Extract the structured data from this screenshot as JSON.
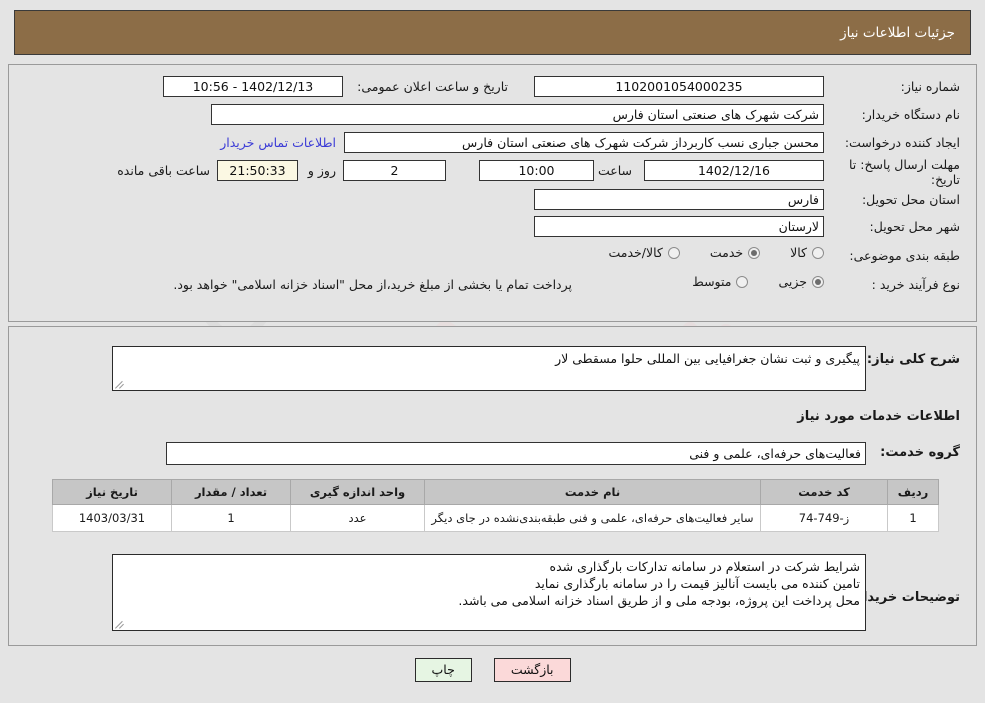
{
  "header": {
    "title": "جزئیات اطلاعات نیاز"
  },
  "top_section": {
    "labels": {
      "need_number": "شماره نیاز:",
      "buyer_org": "نام دستگاه خریدار:",
      "requester": "ایجاد کننده درخواست:",
      "response_deadline": "مهلت ارسال پاسخ: تا تاریخ:",
      "delivery_province": "استان محل تحویل:",
      "delivery_city": "شهر محل تحویل:",
      "subject_classification": "طبقه بندی موضوعی:",
      "purchase_process_type": "نوع فرآیند خرید :",
      "public_announce_datetime": "تاریخ و ساعت اعلان عمومی:",
      "hour": "ساعت",
      "days_and": "روز و",
      "hours_remaining": "ساعت باقی مانده"
    },
    "values": {
      "need_number": "1102001054000235",
      "buyer_org": "شرکت شهرک های صنعتی استان فارس",
      "requester": "محسن  جباری نسب کاربرداز شرکت شهرک های صنعتی استان فارس",
      "response_deadline_date": "1402/12/16",
      "response_deadline_hour": "10:00",
      "remaining_days": "2",
      "remaining_time": "21:50:33",
      "delivery_province": "فارس",
      "delivery_city": "لارستان",
      "public_announce_datetime": "1402/12/13 - 10:56"
    },
    "buyer_contact_link": "اطلاعات تماس خریدار",
    "classification_options": [
      {
        "label": "کالا",
        "selected": false
      },
      {
        "label": "خدمت",
        "selected": true
      },
      {
        "label": "کالا/خدمت",
        "selected": false
      }
    ],
    "process_options": [
      {
        "label": "جزیی",
        "selected": true
      },
      {
        "label": "متوسط",
        "selected": false
      }
    ],
    "treasury_note": "پرداخت تمام یا بخشی از مبلغ خرید،از محل \"اسناد خزانه اسلامی\" خواهد بود."
  },
  "middle_section": {
    "need_summary_label": "شرح کلی نیاز:",
    "need_summary_value": "پیگیری و ثبت نشان جغرافیایی بین المللی حلوا مسقطی لار",
    "services_heading": "اطلاعات خدمات مورد نیاز",
    "service_group_label": "گروه خدمت:",
    "service_group_value": "فعالیت‌های حرفه‌ای، علمی و فنی",
    "table": {
      "headers": [
        "ردیف",
        "کد خدمت",
        "نام خدمت",
        "واحد اندازه گیری",
        "تعداد / مقدار",
        "تاریخ نیاز"
      ],
      "rows": [
        {
          "row_no": "1",
          "service_code": "ز-749-74",
          "service_name": "سایر فعالیت‌های حرفه‌ای، علمی و فنی طبقه‌بندی‌نشده در جای دیگر",
          "unit": "عدد",
          "quantity": "1",
          "need_date": "1403/03/31"
        }
      ]
    },
    "buyer_notes_label": "توضیحات خریدار:",
    "buyer_notes_lines": [
      "شرایط شرکت در استعلام در سامانه تدارکات بارگذاری شده",
      "تامین کننده می بایست آنالیز قیمت را در سامانه بارگذاری نماید",
      "محل پرداخت این پروژه، بودجه ملی و از طریق اسناد خزانه اسلامی می باشد."
    ]
  },
  "footer": {
    "print_button": "چاپ",
    "back_button": "بازگشت"
  },
  "colors": {
    "header_bar": "#8c6d47",
    "page_bg": "#e4e4e4",
    "link": "#3b3bd6",
    "print_btn": "#e6f5e3",
    "back_btn": "#fbd9d9",
    "countdown_bg": "#fbf8e3",
    "table_header": "#c6c6c6"
  }
}
